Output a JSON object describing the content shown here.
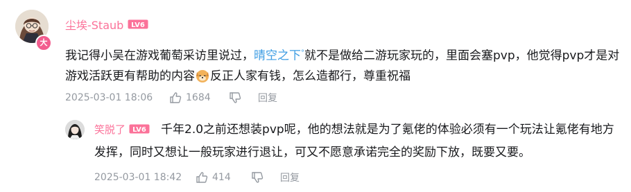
{
  "main_comment": {
    "username": "尘埃-Staub",
    "level": "LV6",
    "avatar_badge": "大",
    "text_part1": "我记得小吴在游戏葡萄采访里说过，",
    "mention": "晴空之下",
    "text_part2": "就不是做给二游玩家玩的，里面会塞pvp，他觉得pvp才是对游戏活跃更有帮助的内容",
    "text_part3": "反正人家有钱，怎么造都行，尊重祝福",
    "timestamp": "2025-03-01 18:06",
    "likes": "1684",
    "reply_label": "回复"
  },
  "sub_comment": {
    "username": "笑脱了",
    "level": "LV6",
    "text": "千年2.0之前还想装pvp呢，他的想法就是为了氪佬的体验必须有一个玩法让氪佬有地方发挥，同时又想让一般玩家进行退让，可又不愿意承诺完全的奖励下放，既要又要。",
    "timestamp": "2025-03-01 18:42",
    "likes": "414",
    "reply_label": "回复"
  },
  "colors": {
    "username": "#fb7299",
    "mention": "#3e9de3",
    "meta": "#9499a0",
    "level_badge": "#fb7299"
  },
  "icons": {
    "like": "thumbs-up-icon",
    "dislike": "thumbs-down-icon",
    "emoji": "dog-emoji-icon"
  }
}
